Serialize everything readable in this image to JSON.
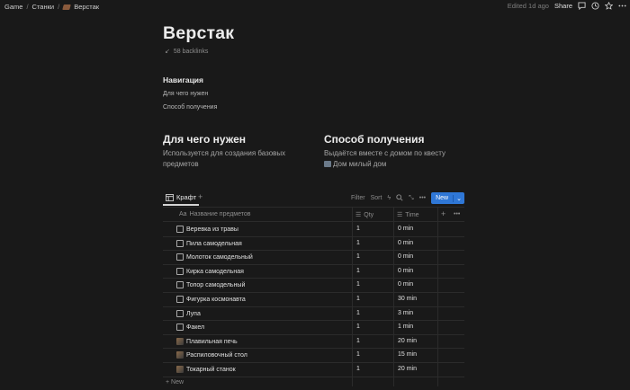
{
  "breadcrumbs": [
    "Game",
    "Станки",
    "Верстак"
  ],
  "topbar": {
    "edited": "Edited 1d ago",
    "share": "Share"
  },
  "page": {
    "title": "Верстак",
    "backlinks": "58 backlinks"
  },
  "navigation": {
    "heading": "Навигация",
    "links": [
      "Для чего нужен",
      "Способ получения"
    ]
  },
  "sections": {
    "purpose": {
      "heading": "Для чего нужен",
      "text": "Используется для создания базовых предметов"
    },
    "obtain": {
      "heading": "Способ получения",
      "text": "Выдаётся вместе с домом по квесту",
      "link": "Дом милый дом"
    }
  },
  "view": {
    "tab": "Крафт",
    "tools": {
      "filter": "Filter",
      "sort": "Sort",
      "new": "New"
    }
  },
  "table": {
    "columns": [
      "Название предметов",
      "Qty",
      "Time"
    ],
    "rows": [
      {
        "name": "Веревка из травы",
        "qty": "1",
        "time": "0 min",
        "icon": "page"
      },
      {
        "name": "Пила самодельная",
        "qty": "1",
        "time": "0 min",
        "icon": "page"
      },
      {
        "name": "Молоток самодельный",
        "qty": "1",
        "time": "0 min",
        "icon": "page"
      },
      {
        "name": "Кирка самодельная",
        "qty": "1",
        "time": "0 min",
        "icon": "page"
      },
      {
        "name": "Топор самодельный",
        "qty": "1",
        "time": "0 min",
        "icon": "page"
      },
      {
        "name": "Фигурка космонавта",
        "qty": "1",
        "time": "30 min",
        "icon": "page"
      },
      {
        "name": "Лупа",
        "qty": "1",
        "time": "3 min",
        "icon": "page"
      },
      {
        "name": "Факел",
        "qty": "1",
        "time": "1 min",
        "icon": "page"
      },
      {
        "name": "Плавильная печь",
        "qty": "1",
        "time": "20 min",
        "icon": "image"
      },
      {
        "name": "Распиловочный стол",
        "qty": "1",
        "time": "15 min",
        "icon": "image"
      },
      {
        "name": "Токарный станок",
        "qty": "1",
        "time": "20 min",
        "icon": "image"
      }
    ],
    "new_row": "New"
  }
}
